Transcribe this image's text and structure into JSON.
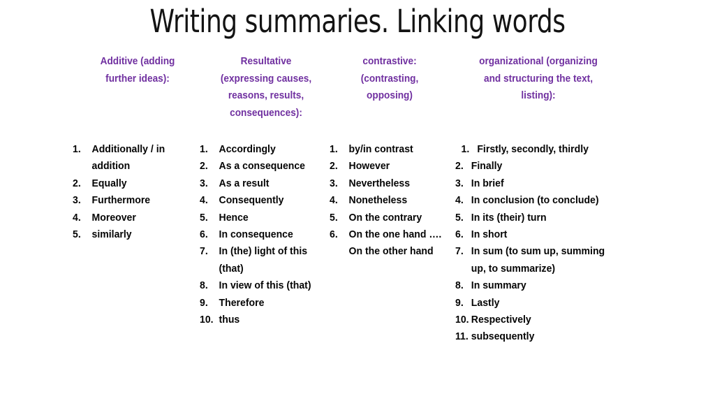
{
  "title": "Writing summaries. Linking words",
  "accent_color": "#7030A0",
  "text_color": "#000000",
  "background_color": "#FFFFFF",
  "columns": [
    {
      "id": "additive",
      "heading": "Additive (adding further ideas):",
      "heading_lines": [
        "Additive (adding",
        "further ideas):"
      ],
      "items": [
        {
          "num": "1.",
          "text": "Additionally / in addition"
        },
        {
          "num": "2.",
          "text": "Equally"
        },
        {
          "num": "3.",
          "text": "Furthermore"
        },
        {
          "num": "4.",
          "text": "Moreover"
        },
        {
          "num": "5.",
          "text": "similarly"
        }
      ]
    },
    {
      "id": "resultative",
      "heading": "Resultative (expressing causes, reasons, results, consequences):",
      "heading_lines": [
        "Resultative",
        "(expressing causes,",
        "reasons, results,",
        "consequences):"
      ],
      "items": [
        {
          "num": "1.",
          "text": "Accordingly"
        },
        {
          "num": "2.",
          "text": "As a consequence"
        },
        {
          "num": "3.",
          "text": "As a result"
        },
        {
          "num": "4.",
          "text": "Consequently"
        },
        {
          "num": "5.",
          "text": "Hence"
        },
        {
          "num": "6.",
          "text": "In consequence"
        },
        {
          "num": "7.",
          "text": "In (the) light of this (that)"
        },
        {
          "num": "8.",
          "text": "In view of this (that)"
        },
        {
          "num": "9.",
          "text": "Therefore"
        },
        {
          "num": "10.",
          "text": "thus"
        }
      ]
    },
    {
      "id": "contrastive",
      "heading": "contrastive: (contrasting, opposing)",
      "heading_lines": [
        "contrastive:",
        "(contrasting,",
        "opposing)"
      ],
      "items": [
        {
          "num": "1.",
          "text": "by/in contrast"
        },
        {
          "num": "2.",
          "text": "However"
        },
        {
          "num": "3.",
          "text": "Nevertheless"
        },
        {
          "num": "4.",
          "text": "Nonetheless"
        },
        {
          "num": "5.",
          "text": "On the contrary"
        },
        {
          "num": "6.",
          "text": "On the one hand …. On the other hand"
        }
      ]
    },
    {
      "id": "organizational",
      "heading": "organizational (organizing and structuring the text, listing):",
      "heading_lines": [
        "organizational (organizing",
        "and structuring the text,",
        "listing):"
      ],
      "items": [
        {
          "num": "1.",
          "text": "Firstly, secondly, thirdly"
        },
        {
          "num": "2.",
          "text": "Finally"
        },
        {
          "num": "3.",
          "text": "In brief"
        },
        {
          "num": "4.",
          "text": "In conclusion (to conclude)"
        },
        {
          "num": "5.",
          "text": "In its (their) turn"
        },
        {
          "num": "6.",
          "text": "In short"
        },
        {
          "num": "7.",
          "text": "In sum (to sum up, summing up, to summarize)"
        },
        {
          "num": "8.",
          "text": "In summary"
        },
        {
          "num": "9.",
          "text": "Lastly"
        },
        {
          "num": "10.",
          "text": "Respectively"
        },
        {
          "num": "11.",
          "text": "subsequently"
        }
      ]
    }
  ]
}
